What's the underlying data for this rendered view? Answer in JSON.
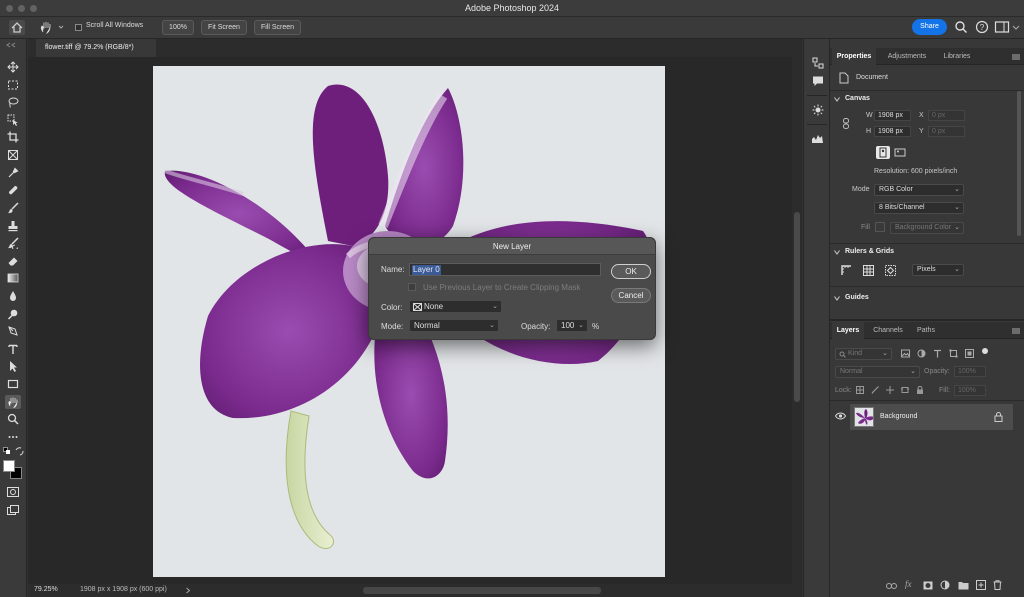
{
  "app": {
    "title": "Adobe Photoshop 2024"
  },
  "options": {
    "scroll_all_windows": "Scroll All Windows",
    "zoom_btn": "100%",
    "fit_screen": "Fit Screen",
    "fill_screen": "Fill Screen",
    "share": "Share"
  },
  "document": {
    "tab": "flower.tiff @ 79.2% (RGB/8*)",
    "zoom": "79.25%",
    "info": "1908 px x 1908 px (600 ppi)"
  },
  "properties": {
    "tabs": [
      "Properties",
      "Adjustments",
      "Libraries"
    ],
    "kind": "Document",
    "canvas": {
      "header": "Canvas",
      "w_label": "W",
      "w": "1908 px",
      "h_label": "H",
      "h": "1908 px",
      "x_label": "X",
      "x": "0 px",
      "y_label": "Y",
      "y": "0 px",
      "resolution": "Resolution: 600 pixels/inch",
      "mode_label": "Mode",
      "mode": "RGB Color",
      "depth": "8 Bits/Channel",
      "fill_label": "Fill",
      "fill": "Background Color"
    },
    "rulers": {
      "header": "Rulers & Grids",
      "units": "Pixels"
    },
    "guides": {
      "header": "Guides"
    }
  },
  "layers": {
    "tabs": [
      "Layers",
      "Channels",
      "Paths"
    ],
    "kind_placeholder": "Kind",
    "blend": "Normal",
    "opacity_label": "Opacity:",
    "opacity": "100%",
    "lock_label": "Lock:",
    "fill_label": "Fill:",
    "fill": "100%",
    "layer_name": "Background"
  },
  "dialog": {
    "title": "New Layer",
    "name_label": "Name:",
    "name_value": "Layer 0",
    "clip_label": "Use Previous Layer to Create Clipping Mask",
    "color_label": "Color:",
    "color_value": "None",
    "mode_label": "Mode:",
    "mode_value": "Normal",
    "opacity_label": "Opacity:",
    "opacity_value": "100",
    "opacity_unit": "%",
    "ok": "OK",
    "cancel": "Cancel"
  },
  "colors": {
    "accent": "#1473e6",
    "panel": "#383838",
    "canvas_bg": "#282828",
    "flower": "#7a2a8c"
  }
}
